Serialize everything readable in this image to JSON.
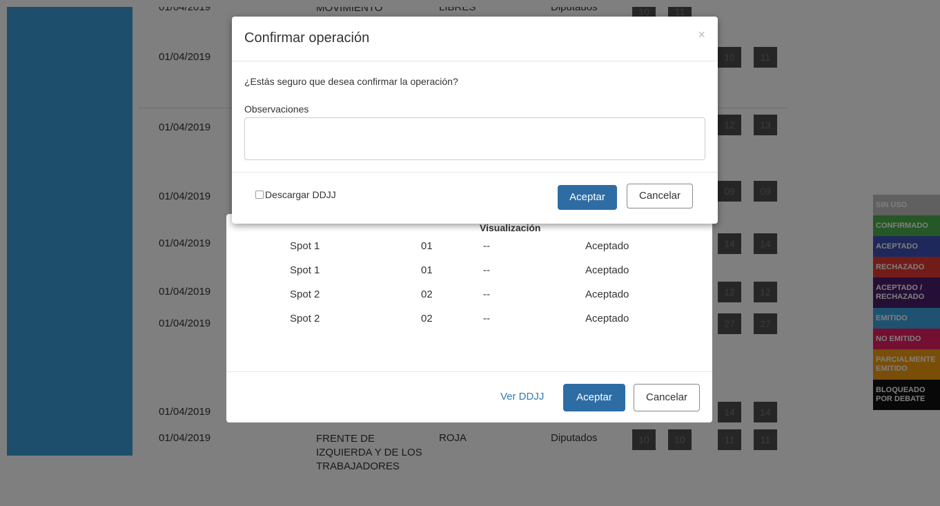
{
  "background": {
    "rows": [
      {
        "date": "01/04/2019",
        "party": "MOVIMIENTO",
        "list": "LIBRES",
        "cargo": "Diputados"
      },
      {
        "date": "01/04/2019"
      },
      {
        "date": "01/04/2019"
      },
      {
        "date": "01/04/2019"
      },
      {
        "date": "01/04/2019"
      },
      {
        "date": "01/04/2019"
      },
      {
        "date": "01/04/2019"
      },
      {
        "date": "01/04/2019"
      },
      {
        "date": "01/04/2019",
        "party": "FRENTE DE IZQUIERDA Y DE LOS TRABAJADORES",
        "list": "ROJA",
        "cargo": "Diputados"
      }
    ],
    "badges": [
      "10",
      "11",
      "12",
      "13",
      "10",
      "11",
      "09",
      "09",
      "14",
      "14",
      "12",
      "12",
      "27",
      "27",
      "14",
      "14",
      "10",
      "10",
      "11",
      "11"
    ]
  },
  "legend": [
    {
      "label": "SIN USO",
      "color": "#c0c0c0"
    },
    {
      "label": "CONFIRMADO",
      "color": "#4cae4c"
    },
    {
      "label": "ACEPTADO",
      "color": "#3f51b5"
    },
    {
      "label": "RECHAZADO",
      "color": "#e53935"
    },
    {
      "label": "ACEPTADO / RECHAZADO",
      "color": "#4a1e6e"
    },
    {
      "label": "EMITIDO",
      "color": "#3da4e0"
    },
    {
      "label": "NO EMITIDO",
      "color": "#e91e63"
    },
    {
      "label": "PARCIALMENTE EMITIDO",
      "color": "#f39c12"
    },
    {
      "label": "BLOQUEADO POR DEBATE",
      "color": "#111111"
    }
  ],
  "modal1": {
    "column_header": "Visualización",
    "rows": [
      {
        "spot": "Spot 1",
        "num": "01",
        "vis": "--",
        "estado": "Aceptado"
      },
      {
        "spot": "Spot 1",
        "num": "01",
        "vis": "--",
        "estado": "Aceptado"
      },
      {
        "spot": "Spot 2",
        "num": "02",
        "vis": "--",
        "estado": "Aceptado"
      },
      {
        "spot": "Spot 2",
        "num": "02",
        "vis": "--",
        "estado": "Aceptado"
      }
    ],
    "ver_ddjj": "Ver DDJJ",
    "accept": "Aceptar",
    "cancel": "Cancelar"
  },
  "modal2": {
    "title": "Confirmar operación",
    "close": "×",
    "question": "¿Estás seguro que desea confirmar la operación?",
    "obs_label": "Observaciones",
    "obs_value": "",
    "checkbox_label": "Descargar DDJJ",
    "accept": "Aceptar",
    "cancel": "Cancelar"
  }
}
